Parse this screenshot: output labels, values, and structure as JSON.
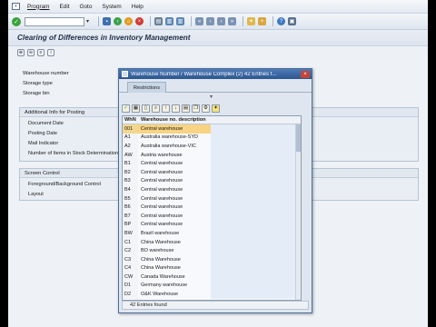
{
  "menu": {
    "items": [
      "Program",
      "Edit",
      "Goto",
      "System",
      "Help"
    ]
  },
  "title": "Clearing of Differences in Inventory Management",
  "fields": {
    "warehouse_number": "Warehouse number",
    "storage_type": "Storage type",
    "storage_bin": "Storage bin"
  },
  "posting_group": {
    "header": "Additional Info for Posting",
    "labels": [
      "Document Date",
      "Posting Date",
      "Mail Indicator",
      "Number of Items in Stock Determination"
    ]
  },
  "screen_group": {
    "header": "Screen Control",
    "labels": [
      "Foreground/Background Control",
      "Layout"
    ]
  },
  "popup": {
    "title": "Warehouse Number / Warehouse Complex (2)   42 Entries f...",
    "tab": "Restrictions",
    "col_whn": "WhN",
    "col_desc": "Warehouse no. description",
    "rows": [
      {
        "code": "001",
        "desc": "Central warehouse"
      },
      {
        "code": "A1",
        "desc": "Australia warehouse-SYD"
      },
      {
        "code": "A2",
        "desc": "Australia warehouse-VIC"
      },
      {
        "code": "AW",
        "desc": "Austria warehouse"
      },
      {
        "code": "B1",
        "desc": "Central warehouse"
      },
      {
        "code": "B2",
        "desc": "Central warehouse"
      },
      {
        "code": "B3",
        "desc": "Central warehouse"
      },
      {
        "code": "B4",
        "desc": "Central warehouse"
      },
      {
        "code": "B5",
        "desc": "Central warehouse"
      },
      {
        "code": "B6",
        "desc": "Central warehouse"
      },
      {
        "code": "B7",
        "desc": "Central warehouse"
      },
      {
        "code": "BP",
        "desc": "Central warehouse"
      },
      {
        "code": "BW",
        "desc": "Brazil warehouse"
      },
      {
        "code": "C1",
        "desc": "China Warehouse"
      },
      {
        "code": "C2",
        "desc": "BO warehouse"
      },
      {
        "code": "C3",
        "desc": "China Warehouse"
      },
      {
        "code": "C4",
        "desc": "China Warehouse"
      },
      {
        "code": "CW",
        "desc": "Canada Warehouse"
      },
      {
        "code": "D1",
        "desc": "Germany warehouse"
      },
      {
        "code": "D2",
        "desc": "O&K Warehouse"
      }
    ],
    "status": "42 Entries found"
  }
}
